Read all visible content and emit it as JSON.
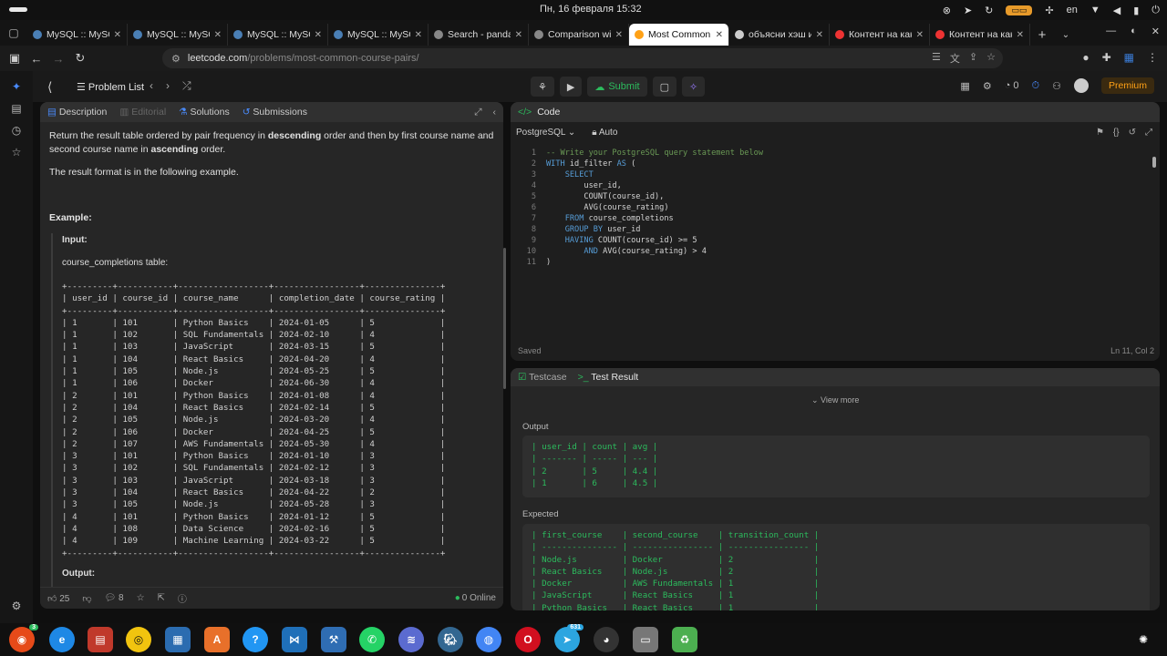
{
  "os": {
    "clock": "Пн, 16 февраля 15:32",
    "lang": "en"
  },
  "browser": {
    "tabs": [
      {
        "title": "MySQL :: MySQL",
        "color": "#4a7fb5"
      },
      {
        "title": "MySQL :: MySQL",
        "color": "#4a7fb5"
      },
      {
        "title": "MySQL :: MySQL",
        "color": "#4a7fb5"
      },
      {
        "title": "MySQL :: MySQL",
        "color": "#4a7fb5"
      },
      {
        "title": "Search - pandas",
        "color": "#888888"
      },
      {
        "title": "Comparison wit",
        "color": "#888888"
      },
      {
        "title": "Most Common C",
        "color": "#ffa116",
        "active": true
      },
      {
        "title": "объясни хэш и",
        "color": "#cccccc"
      },
      {
        "title": "Контент на кан",
        "color": "#e33"
      },
      {
        "title": "Контент на кан",
        "color": "#e33"
      }
    ],
    "url_host": "leetcode.com",
    "url_path": "/problems/most-common-course-pairs/"
  },
  "leetcode": {
    "problem_list": "Problem List",
    "submit": "Submit",
    "streak": "0",
    "premium": "Premium",
    "panel_tabs": {
      "description": "Description",
      "editorial": "Editorial",
      "solutions": "Solutions",
      "submissions": "Submissions"
    },
    "description": {
      "p1_a": "Return the result table ordered by pair frequency in ",
      "p1_b": "descending",
      "p1_c": " order and then by first course name and second course name in ",
      "p1_d": "ascending",
      "p1_e": " order.",
      "p2": "The result format is in the following example.",
      "example": "Example:",
      "input": "Input:",
      "table_name": "course_completions table:",
      "output": "Output:"
    },
    "ascii_table": "+---------+-----------+------------------+-----------------+---------------+\n| user_id | course_id | course_name      | completion_date | course_rating |\n+---------+-----------+------------------+-----------------+---------------+\n| 1       | 101       | Python Basics    | 2024-01-05      | 5             |\n| 1       | 102       | SQL Fundamentals | 2024-02-10      | 4             |\n| 1       | 103       | JavaScript       | 2024-03-15      | 5             |\n| 1       | 104       | React Basics     | 2024-04-20      | 4             |\n| 1       | 105       | Node.js          | 2024-05-25      | 5             |\n| 1       | 106       | Docker           | 2024-06-30      | 4             |\n| 2       | 101       | Python Basics    | 2024-01-08      | 4             |\n| 2       | 104       | React Basics     | 2024-02-14      | 5             |\n| 2       | 105       | Node.js          | 2024-03-20      | 4             |\n| 2       | 106       | Docker           | 2024-04-25      | 5             |\n| 2       | 107       | AWS Fundamentals | 2024-05-30      | 4             |\n| 3       | 101       | Python Basics    | 2024-01-10      | 3             |\n| 3       | 102       | SQL Fundamentals | 2024-02-12      | 3             |\n| 3       | 103       | JavaScript       | 2024-03-18      | 3             |\n| 3       | 104       | React Basics     | 2024-04-22      | 2             |\n| 3       | 105       | Node.js          | 2024-05-28      | 3             |\n| 4       | 101       | Python Basics    | 2024-01-12      | 5             |\n| 4       | 108       | Data Science     | 2024-02-16      | 5             |\n| 4       | 109       | Machine Learning | 2024-03-22      | 5             |\n+---------+-----------+------------------+-----------------+---------------+",
    "footer": {
      "likes": "25",
      "comments": "8",
      "online": "0 Online"
    },
    "code": {
      "tab": "Code",
      "language": "PostgreSQL",
      "mode": "Auto",
      "saved": "Saved",
      "position": "Ln 11, Col 2",
      "lines": [
        {
          "n": "1",
          "parts": [
            {
              "c": "cm",
              "t": "-- Write your PostgreSQL query statement below"
            }
          ]
        },
        {
          "n": "2",
          "parts": [
            {
              "c": "kw",
              "t": "WITH "
            },
            {
              "c": "tx",
              "t": "id_filter "
            },
            {
              "c": "kw",
              "t": "AS "
            },
            {
              "c": "tx",
              "t": "("
            }
          ]
        },
        {
          "n": "3",
          "parts": [
            {
              "c": "kw",
              "t": "    SELECT"
            }
          ]
        },
        {
          "n": "4",
          "parts": [
            {
              "c": "tx",
              "t": "        user_id,"
            }
          ]
        },
        {
          "n": "5",
          "parts": [
            {
              "c": "tx",
              "t": "        COUNT(course_id),"
            }
          ]
        },
        {
          "n": "6",
          "parts": [
            {
              "c": "tx",
              "t": "        AVG(course_rating)"
            }
          ]
        },
        {
          "n": "7",
          "parts": [
            {
              "c": "kw",
              "t": "    FROM "
            },
            {
              "c": "tx",
              "t": "course_completions"
            }
          ]
        },
        {
          "n": "8",
          "parts": [
            {
              "c": "kw",
              "t": "    GROUP BY "
            },
            {
              "c": "tx",
              "t": "user_id"
            }
          ]
        },
        {
          "n": "9",
          "parts": [
            {
              "c": "kw",
              "t": "    HAVING "
            },
            {
              "c": "tx",
              "t": "COUNT(course_id) >= 5"
            }
          ]
        },
        {
          "n": "10",
          "parts": [
            {
              "c": "kw",
              "t": "        AND "
            },
            {
              "c": "tx",
              "t": "AVG(course_rating) > 4"
            }
          ]
        },
        {
          "n": "11",
          "parts": [
            {
              "c": "tx",
              "t": ")"
            }
          ]
        }
      ]
    },
    "result": {
      "testcase": "Testcase",
      "test_result": "Test Result",
      "view_more": "View more",
      "output_label": "Output",
      "expected_label": "Expected",
      "output_table": "| user_id | count | avg |\n| ------- | ----- | --- |\n| 2       | 5     | 4.4 |\n| 1       | 6     | 4.5 |",
      "expected_table": "| first_course    | second_course    | transition_count |\n| --------------- | ---------------- | ---------------- |\n| Node.js         | Docker           | 2                |\n| React Basics    | Node.js          | 2                |\n| Docker          | AWS Fundamentals | 1                |\n| JavaScript      | React Basics     | 1                |\n| Python Basics   | React Basics     | 1                |"
    }
  },
  "colors": {
    "accent_green": "#2cbb5d",
    "premium_orange": "#ffa116",
    "error_red": "#ef4743"
  }
}
